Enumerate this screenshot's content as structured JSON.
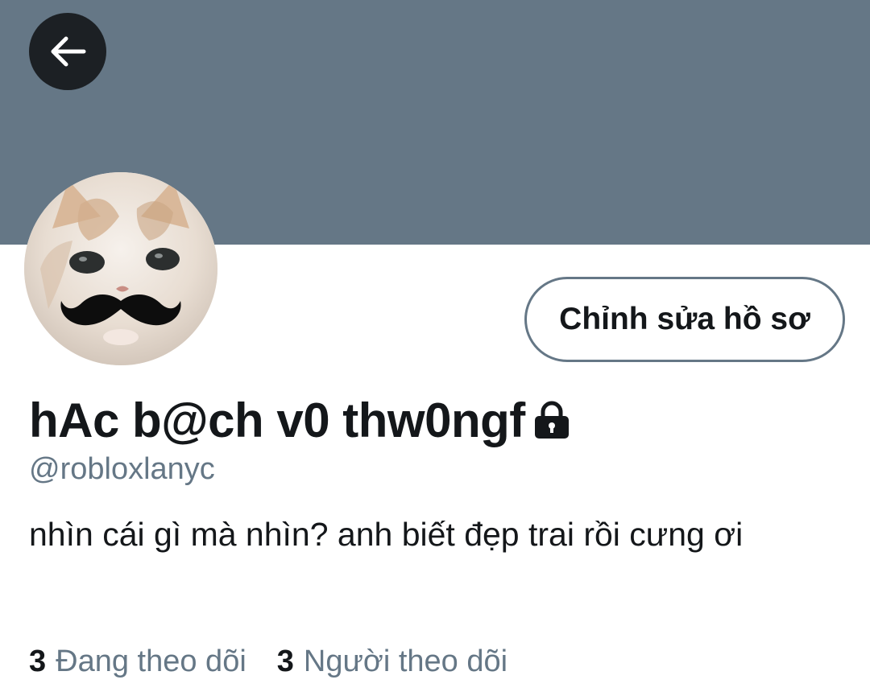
{
  "profile": {
    "display_name": "hAc b@ch v0 thw0ngf",
    "handle": "@robloxlanyc",
    "bio": "nhìn cái gì mà nhìn? anh biết đẹp trai rồi cưng ơi",
    "edit_button_label": "Chỉnh sửa hồ sơ",
    "protected": true
  },
  "stats": {
    "following_count": "3",
    "following_label": "Đang theo dõi",
    "followers_count": "3",
    "followers_label": "Người theo dõi"
  },
  "icons": {
    "back": "arrow-left-icon",
    "lock": "lock-icon"
  },
  "colors": {
    "banner": "#657786",
    "text_primary": "#14171a",
    "text_secondary": "#657786",
    "back_button_bg": "#1c2024"
  }
}
